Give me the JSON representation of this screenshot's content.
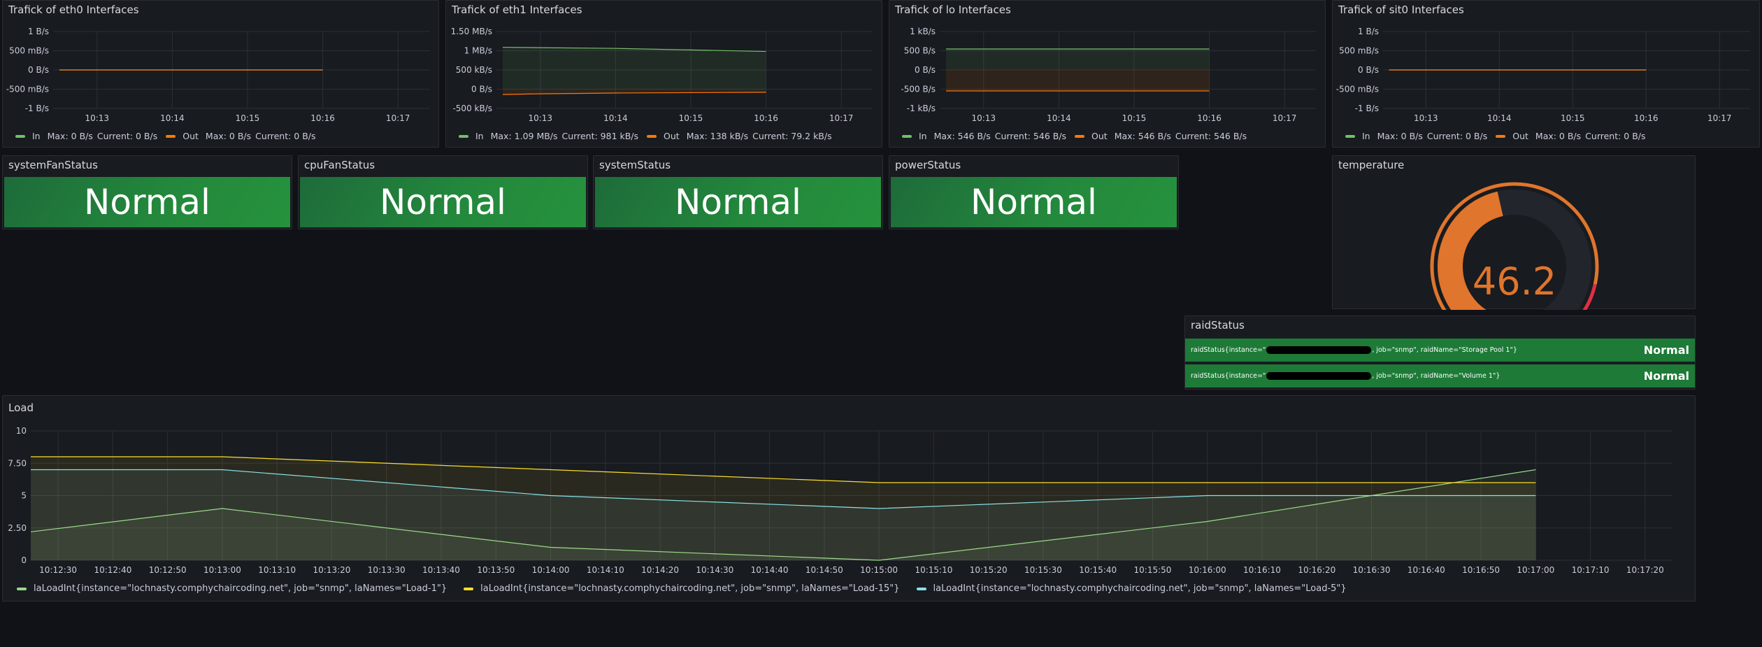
{
  "traffic_panels": [
    {
      "title": "Trafick of eth0 Interfaces",
      "y_ticks": [
        "1 B/s",
        "500 mB/s",
        "0 B/s",
        "-500 mB/s",
        "-1 B/s"
      ],
      "x_ticks": [
        "10:13",
        "10:14",
        "10:15",
        "10:16",
        "10:17"
      ],
      "legend": [
        {
          "name": "In",
          "max": "Max: 0 B/s",
          "current": "Current: 0 B/s",
          "color": "#73bf69"
        },
        {
          "name": "Out",
          "max": "Max: 0 B/s",
          "current": "Current: 0 B/s",
          "color": "#ff780a"
        }
      ]
    },
    {
      "title": "Trafick of eth1 Interfaces",
      "y_ticks": [
        "1.50 MB/s",
        "1 MB/s",
        "500 kB/s",
        "0 B/s",
        "-500 kB/s"
      ],
      "x_ticks": [
        "10:13",
        "10:14",
        "10:15",
        "10:16",
        "10:17"
      ],
      "legend": [
        {
          "name": "In",
          "max": "Max: 1.09 MB/s",
          "current": "Current: 981 kB/s",
          "color": "#73bf69"
        },
        {
          "name": "Out",
          "max": "Max: 138 kB/s",
          "current": "Current: 79.2 kB/s",
          "color": "#ff780a"
        }
      ]
    },
    {
      "title": "Trafick of lo Interfaces",
      "y_ticks": [
        "1 kB/s",
        "500 B/s",
        "0 B/s",
        "-500 B/s",
        "-1 kB/s"
      ],
      "x_ticks": [
        "10:13",
        "10:14",
        "10:15",
        "10:16",
        "10:17"
      ],
      "legend": [
        {
          "name": "In",
          "max": "Max: 546 B/s",
          "current": "Current: 546 B/s",
          "color": "#73bf69"
        },
        {
          "name": "Out",
          "max": "Max: 546 B/s",
          "current": "Current: 546 B/s",
          "color": "#ff780a"
        }
      ]
    },
    {
      "title": "Trafick of sit0 Interfaces",
      "y_ticks": [
        "1 B/s",
        "500 mB/s",
        "0 B/s",
        "-500 mB/s",
        "-1 B/s"
      ],
      "x_ticks": [
        "10:13",
        "10:14",
        "10:15",
        "10:16",
        "10:17"
      ],
      "legend": [
        {
          "name": "In",
          "max": "Max: 0 B/s",
          "current": "Current: 0 B/s",
          "color": "#73bf69"
        },
        {
          "name": "Out",
          "max": "Max: 0 B/s",
          "current": "Current: 0 B/s",
          "color": "#ff780a"
        }
      ]
    }
  ],
  "status_panels": [
    {
      "title": "systemFanStatus",
      "value": "Normal"
    },
    {
      "title": "cpuFanStatus",
      "value": "Normal"
    },
    {
      "title": "systemStatus",
      "value": "Normal"
    },
    {
      "title": "powerStatus",
      "value": "Normal"
    }
  ],
  "temperature": {
    "title": "temperature",
    "value": "46.2",
    "value_color": "#e0752d",
    "gauge_fill_fraction": 0.46
  },
  "raid": {
    "title": "raidStatus",
    "rows": [
      {
        "label_start": "raidStatus{instance=\"",
        "label_end": ", job=\"snmp\", raidName=\"Storage Pool 1\"}",
        "value": "Normal"
      },
      {
        "label_start": "raidStatus{instance=\"",
        "label_end": ", job=\"snmp\", raidName=\"Volume 1\"}",
        "value": "Normal"
      }
    ]
  },
  "load": {
    "title": "Load",
    "legend": [
      {
        "name": "laLoadInt{instance=\"lochnasty.comphychaircoding.net\", job=\"snmp\", laNames=\"Load-1\"}",
        "color": "#96d98d"
      },
      {
        "name": "laLoadInt{instance=\"lochnasty.comphychaircoding.net\", job=\"snmp\", laNames=\"Load-15\"}",
        "color": "#fade2a"
      },
      {
        "name": "laLoadInt{instance=\"lochnasty.comphychaircoding.net\", job=\"snmp\", laNames=\"Load-5\"}",
        "color": "#8ae0e8"
      }
    ]
  },
  "chart_data": [
    {
      "type": "line",
      "title": "Trafick of eth0 Interfaces",
      "x": [
        "10:12:30",
        "10:16:00"
      ],
      "series": [
        {
          "name": "In",
          "values": [
            0,
            0
          ]
        },
        {
          "name": "Out",
          "values": [
            0,
            0
          ]
        }
      ],
      "ylim": [
        -1,
        1
      ],
      "y_unit": "B/s"
    },
    {
      "type": "area",
      "title": "Trafick of eth1 Interfaces",
      "x": [
        "10:12:30",
        "10:13:00",
        "10:14:00",
        "10:15:00",
        "10:16:00"
      ],
      "series": [
        {
          "name": "In",
          "values": [
            1.09,
            1.08,
            1.06,
            1.02,
            0.981
          ]
        },
        {
          "name": "Out",
          "values": [
            -0.138,
            -0.12,
            -0.1,
            -0.09,
            -0.0792
          ]
        }
      ],
      "ylim": [
        -0.5,
        1.5
      ],
      "y_unit": "MB/s"
    },
    {
      "type": "area",
      "title": "Trafick of lo Interfaces",
      "x": [
        "10:12:30",
        "10:16:00"
      ],
      "series": [
        {
          "name": "In",
          "values": [
            546,
            546
          ]
        },
        {
          "name": "Out",
          "values": [
            -546,
            -546
          ]
        }
      ],
      "ylim": [
        -1000,
        1000
      ],
      "y_unit": "B/s"
    },
    {
      "type": "line",
      "title": "Trafick of sit0 Interfaces",
      "x": [
        "10:12:30",
        "10:16:00"
      ],
      "series": [
        {
          "name": "In",
          "values": [
            0,
            0
          ]
        },
        {
          "name": "Out",
          "values": [
            0,
            0
          ]
        }
      ],
      "ylim": [
        -1,
        1
      ],
      "y_unit": "B/s"
    },
    {
      "type": "area",
      "title": "Load",
      "x_ticks": [
        "10:12:30",
        "10:12:40",
        "10:12:50",
        "10:13:00",
        "10:13:10",
        "10:13:20",
        "10:13:30",
        "10:13:40",
        "10:13:50",
        "10:14:00",
        "10:14:10",
        "10:14:20",
        "10:14:30",
        "10:14:40",
        "10:14:50",
        "10:15:00",
        "10:15:10",
        "10:15:20",
        "10:15:30",
        "10:15:40",
        "10:15:50",
        "10:16:00",
        "10:16:10",
        "10:16:20",
        "10:16:30",
        "10:16:40",
        "10:16:50",
        "10:17:00",
        "10:17:10",
        "10:17:20"
      ],
      "y_ticks": [
        "0",
        "2.50",
        "5",
        "7.50",
        "10"
      ],
      "x": [
        "10:12:25",
        "10:13:00",
        "10:14:00",
        "10:15:00",
        "10:16:00",
        "10:17:00"
      ],
      "series": [
        {
          "name": "laLoadInt{instance=\"lochnasty.comphychaircoding.net\", job=\"snmp\", laNames=\"Load-1\"}",
          "values": [
            2.2,
            4,
            1,
            0,
            3,
            7
          ]
        },
        {
          "name": "laLoadInt{instance=\"lochnasty.comphychaircoding.net\", job=\"snmp\", laNames=\"Load-15\"}",
          "values": [
            8,
            8,
            7,
            6,
            6,
            6
          ]
        },
        {
          "name": "laLoadInt{instance=\"lochnasty.comphychaircoding.net\", job=\"snmp\", laNames=\"Load-5\"}",
          "values": [
            7,
            7,
            5,
            4,
            5,
            5
          ]
        }
      ],
      "ylim": [
        0,
        10
      ],
      "grid": true,
      "legend": "bottom"
    }
  ]
}
